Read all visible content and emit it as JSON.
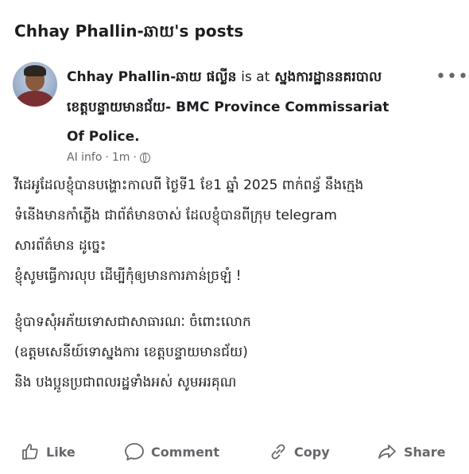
{
  "page": {
    "title": "Chhay Phallin-ឆាយ's posts"
  },
  "post": {
    "author": "Chhay Phallin-ឆាយ ផល្លីន",
    "author_at": "is at",
    "location_line1": "ស្នងការដ្ឋាននគរបាល",
    "location_line2": "ខេត្តបន្ទាយមានជ័យ- BMC Province Commissariat",
    "location_line3": "Of Police.",
    "meta_label": "AI info",
    "meta_sep": "·",
    "meta_time": "1m",
    "meta_sep2": "·",
    "body_lines": [
      "វីដេអូដែលខ្ញុំបានបង្ហោះកាលពី ថ្ងៃទី1 ខែ1 ឆ្នាំ 2025 ពាក់ពន្ធ័ នឹងក្មេង",
      "ទំនើងមានកាំភ្លើង ជាព័ត៌មានចាស់ ដែលខ្ញុំបានពីក្រុម telegram",
      "សារព័ត៌មាន ដូច្នេះ",
      "ខ្ញុំសូមធ្វើការលុប ដើម្បីកុំឲ្យមានការភាន់ច្រឡំ !"
    ],
    "body_lines_2": [
      "ខ្ញុំបាទសុំអភ័យទោសជាសាធារណៈ ចំពោះលោក",
      "(ឧត្តមសេនីយ៍ទោស្នងការ ខេត្តបន្ទាយមានជ័យ)",
      "និង បងប្អូនប្រជាពលរដ្ឋទាំងអស់ សូមអរគុណ"
    ]
  },
  "actions": {
    "like": "Like",
    "comment": "Comment",
    "copy": "Copy",
    "share": "Share"
  },
  "icons": [
    "more-icon",
    "globe-icon",
    "like-icon",
    "comment-icon",
    "copy-icon",
    "share-icon"
  ]
}
